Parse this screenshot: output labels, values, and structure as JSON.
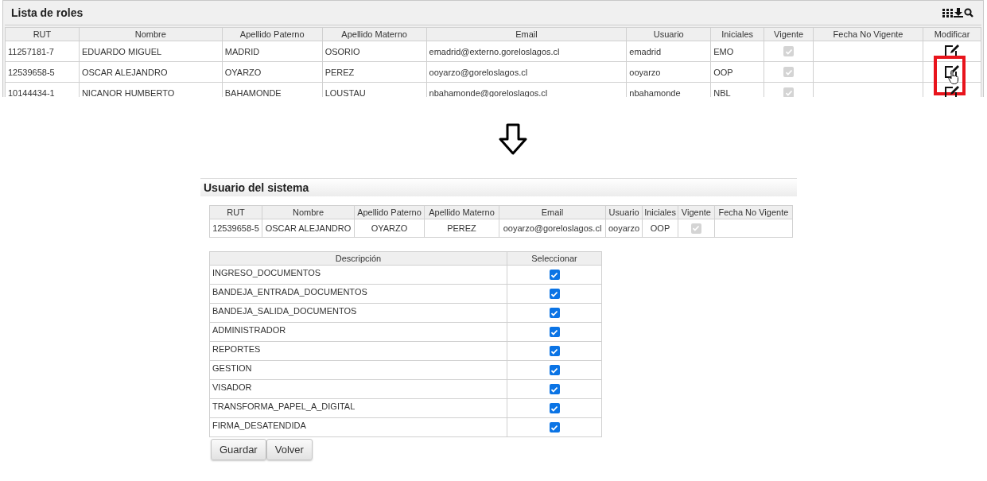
{
  "roles_list": {
    "title": "Lista de roles",
    "columns": [
      "RUT",
      "Nombre",
      "Apellido Paterno",
      "Apellido Materno",
      "Email",
      "Usuario",
      "Iniciales",
      "Vigente",
      "Fecha No Vigente",
      "Modificar"
    ],
    "rows": [
      {
        "cells": [
          "11257181-7",
          "EDUARDO MIGUEL",
          "MADRID",
          "OSORIO",
          "emadrid@externo.goreloslagos.cl",
          "emadrid",
          "EMO"
        ],
        "vigente": true,
        "highlighted": false
      },
      {
        "cells": [
          "12539658-5",
          "OSCAR ALEJANDRO",
          "OYARZO",
          "PEREZ",
          "ooyarzo@goreloslagos.cl",
          "ooyarzo",
          "OOP"
        ],
        "vigente": true,
        "highlighted": true
      },
      {
        "cells": [
          "10144434-1",
          "NICANOR HUMBERTO",
          "BAHAMONDE",
          "LOUSTAU",
          "nbahamonde@goreloslagos.cl",
          "nbahamonde",
          "NBL"
        ],
        "vigente": true,
        "highlighted": false
      }
    ]
  },
  "user_panel": {
    "title": "Usuario del sistema",
    "columns": [
      "RUT",
      "Nombre",
      "Apellido Paterno",
      "Apellido Materno",
      "Email",
      "Usuario",
      "Iniciales",
      "Vigente",
      "Fecha No Vigente"
    ],
    "row": {
      "cells": [
        "12539658-5",
        "OSCAR ALEJANDRO",
        "OYARZO",
        "PEREZ",
        "ooyarzo@goreloslagos.cl",
        "ooyarzo",
        "OOP"
      ],
      "vigente": true
    }
  },
  "roles": {
    "columns": [
      "Descripción",
      "Seleccionar"
    ],
    "items": [
      {
        "label": "INGRESO_DOCUMENTOS",
        "checked": true
      },
      {
        "label": "BANDEJA_ENTRADA_DOCUMENTOS",
        "checked": true
      },
      {
        "label": "BANDEJA_SALIDA_DOCUMENTOS",
        "checked": true
      },
      {
        "label": "ADMINISTRADOR",
        "checked": true
      },
      {
        "label": "REPORTES",
        "checked": true
      },
      {
        "label": "GESTION",
        "checked": true
      },
      {
        "label": "VISADOR",
        "checked": true
      },
      {
        "label": "TRANSFORMA_PAPEL_A_DIGITAL",
        "checked": true
      },
      {
        "label": "FIRMA_DESATENDIDA",
        "checked": true
      }
    ]
  },
  "buttons": [
    "Guardar",
    "Volver"
  ]
}
